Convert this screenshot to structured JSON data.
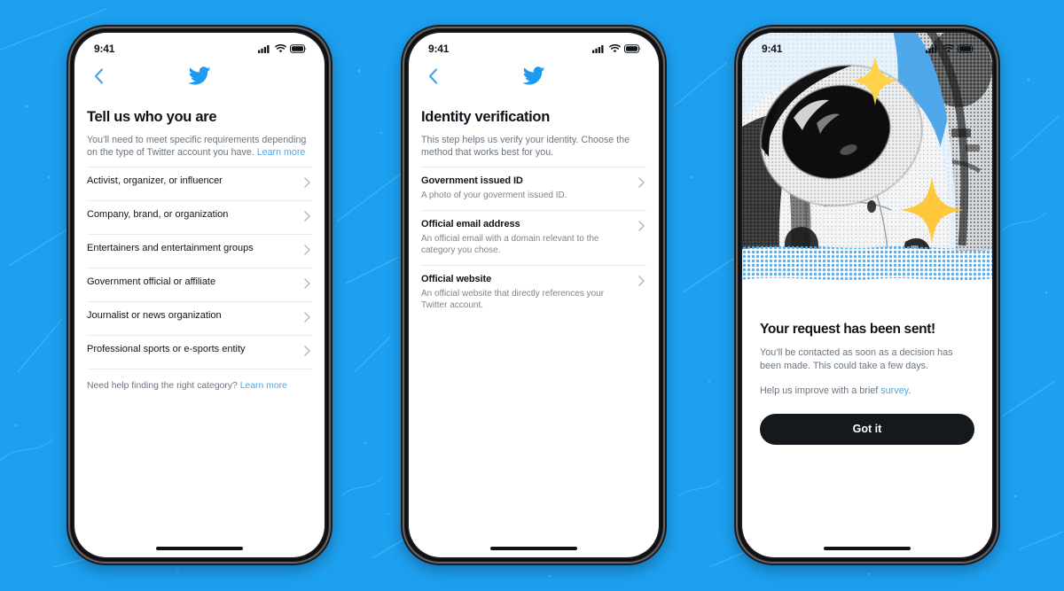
{
  "theme": {
    "background_blue": "#1DA0F0",
    "twitter_blue": "#1D9BF0",
    "link_blue": "#4AA8E8",
    "text_primary": "#0F1419",
    "text_secondary": "#6B7580",
    "divider": "#E9ECEE",
    "button_dark": "#15181C",
    "sparkle_yellow": "#FFD24A"
  },
  "status_bar": {
    "time": "9:41",
    "signal_icon": "cellular-signal-icon",
    "wifi_icon": "wifi-icon",
    "battery_icon": "battery-icon"
  },
  "nav": {
    "back_icon": "chevron-left-icon",
    "logo_icon": "twitter-bird-icon"
  },
  "screens": [
    {
      "id": "tell-us-who-you-are",
      "title": "Tell us who you are",
      "intro": "You’ll need to meet specific requirements depending on the type of Twitter account you have. ",
      "intro_link": "Learn more",
      "options": [
        {
          "label": "Activist, organizer, or influencer"
        },
        {
          "label": "Company, brand, or organization"
        },
        {
          "label": "Entertainers and entertainment groups"
        },
        {
          "label": "Government official or affiliate"
        },
        {
          "label": "Journalist or news organization"
        },
        {
          "label": "Professional sports or e-sports entity"
        }
      ],
      "footnote": "Need help finding the right category? ",
      "footnote_link": "Learn more"
    },
    {
      "id": "identity-verification",
      "title": "Identity verification",
      "intro": "This step helps us verify your identity. Choose the method that works best for you.",
      "options": [
        {
          "label": "Government issued ID",
          "sub": "A photo of your goverment issued ID."
        },
        {
          "label": "Official email address",
          "sub": "An official email with a domain relevant to the category you chose."
        },
        {
          "label": "Official website",
          "sub": "An official website that directly references your Twitter account."
        }
      ]
    },
    {
      "id": "request-sent",
      "hero_image": "astronaut-halftone-illustration",
      "title": "Your request has been sent!",
      "text": "You’ll be contacted as soon as a decision has been made. This could take a few days.",
      "survey_prefix": "Help us improve with a brief ",
      "survey_link": "survey",
      "survey_suffix": ".",
      "button_label": "Got it"
    }
  ]
}
